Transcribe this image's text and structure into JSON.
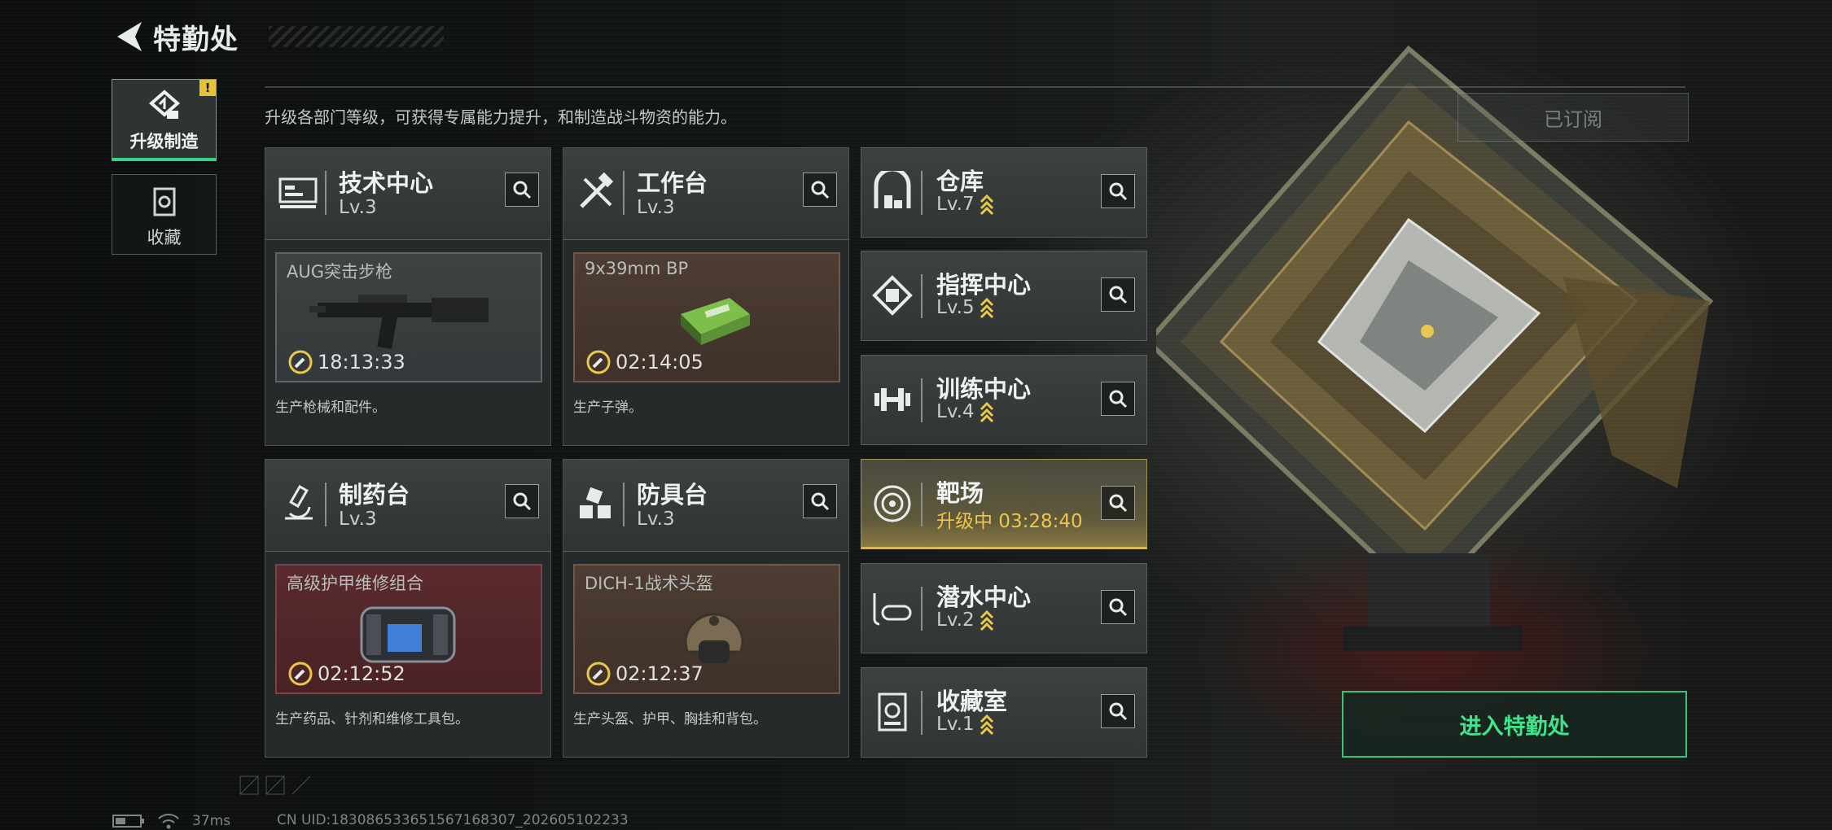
{
  "header": {
    "title": "特勤处"
  },
  "nav": [
    {
      "label": "升级制造",
      "badge": "!"
    },
    {
      "label": "收藏"
    }
  ],
  "subtitle": "升级各部门等级，可获得专属能力提升，和制造战斗物资的能力。",
  "subscribed_label": "已订阅",
  "enter_button": "进入特勤处",
  "departments": [
    {
      "name": "技术中心",
      "level": "Lv.3",
      "product": "AUG突击步枪",
      "timer": "18:13:33",
      "desc": "生产枪械和配件。"
    },
    {
      "name": "工作台",
      "level": "Lv.3",
      "product": "9x39mm BP",
      "timer": "02:14:05",
      "desc": "生产子弹。"
    },
    {
      "name": "制药台",
      "level": "Lv.3",
      "product": "高级护甲维修组合",
      "timer": "02:12:52",
      "desc": "生产药品、针剂和维修工具包。"
    },
    {
      "name": "防具台",
      "level": "Lv.3",
      "product": "DICH-1战术头盔",
      "timer": "02:12:37",
      "desc": "生产头盔、护甲、胸挂和背包。"
    }
  ],
  "facilities": [
    {
      "name": "仓库",
      "level": "Lv.7"
    },
    {
      "name": "指挥中心",
      "level": "Lv.5"
    },
    {
      "name": "训练中心",
      "level": "Lv.4"
    },
    {
      "name": "靶场",
      "level": "升级中 03:28:40"
    },
    {
      "name": "潜水中心",
      "level": "Lv.2"
    },
    {
      "name": "收藏室",
      "level": "Lv.1"
    }
  ],
  "status": {
    "ping": "37ms",
    "uid": "CN UID:1830865336515671683​07_202605102233"
  },
  "colors": {
    "accent_green": "#36d583",
    "upgrade_gold": "#f0c64a",
    "warning_yellow": "#e6c13a"
  }
}
